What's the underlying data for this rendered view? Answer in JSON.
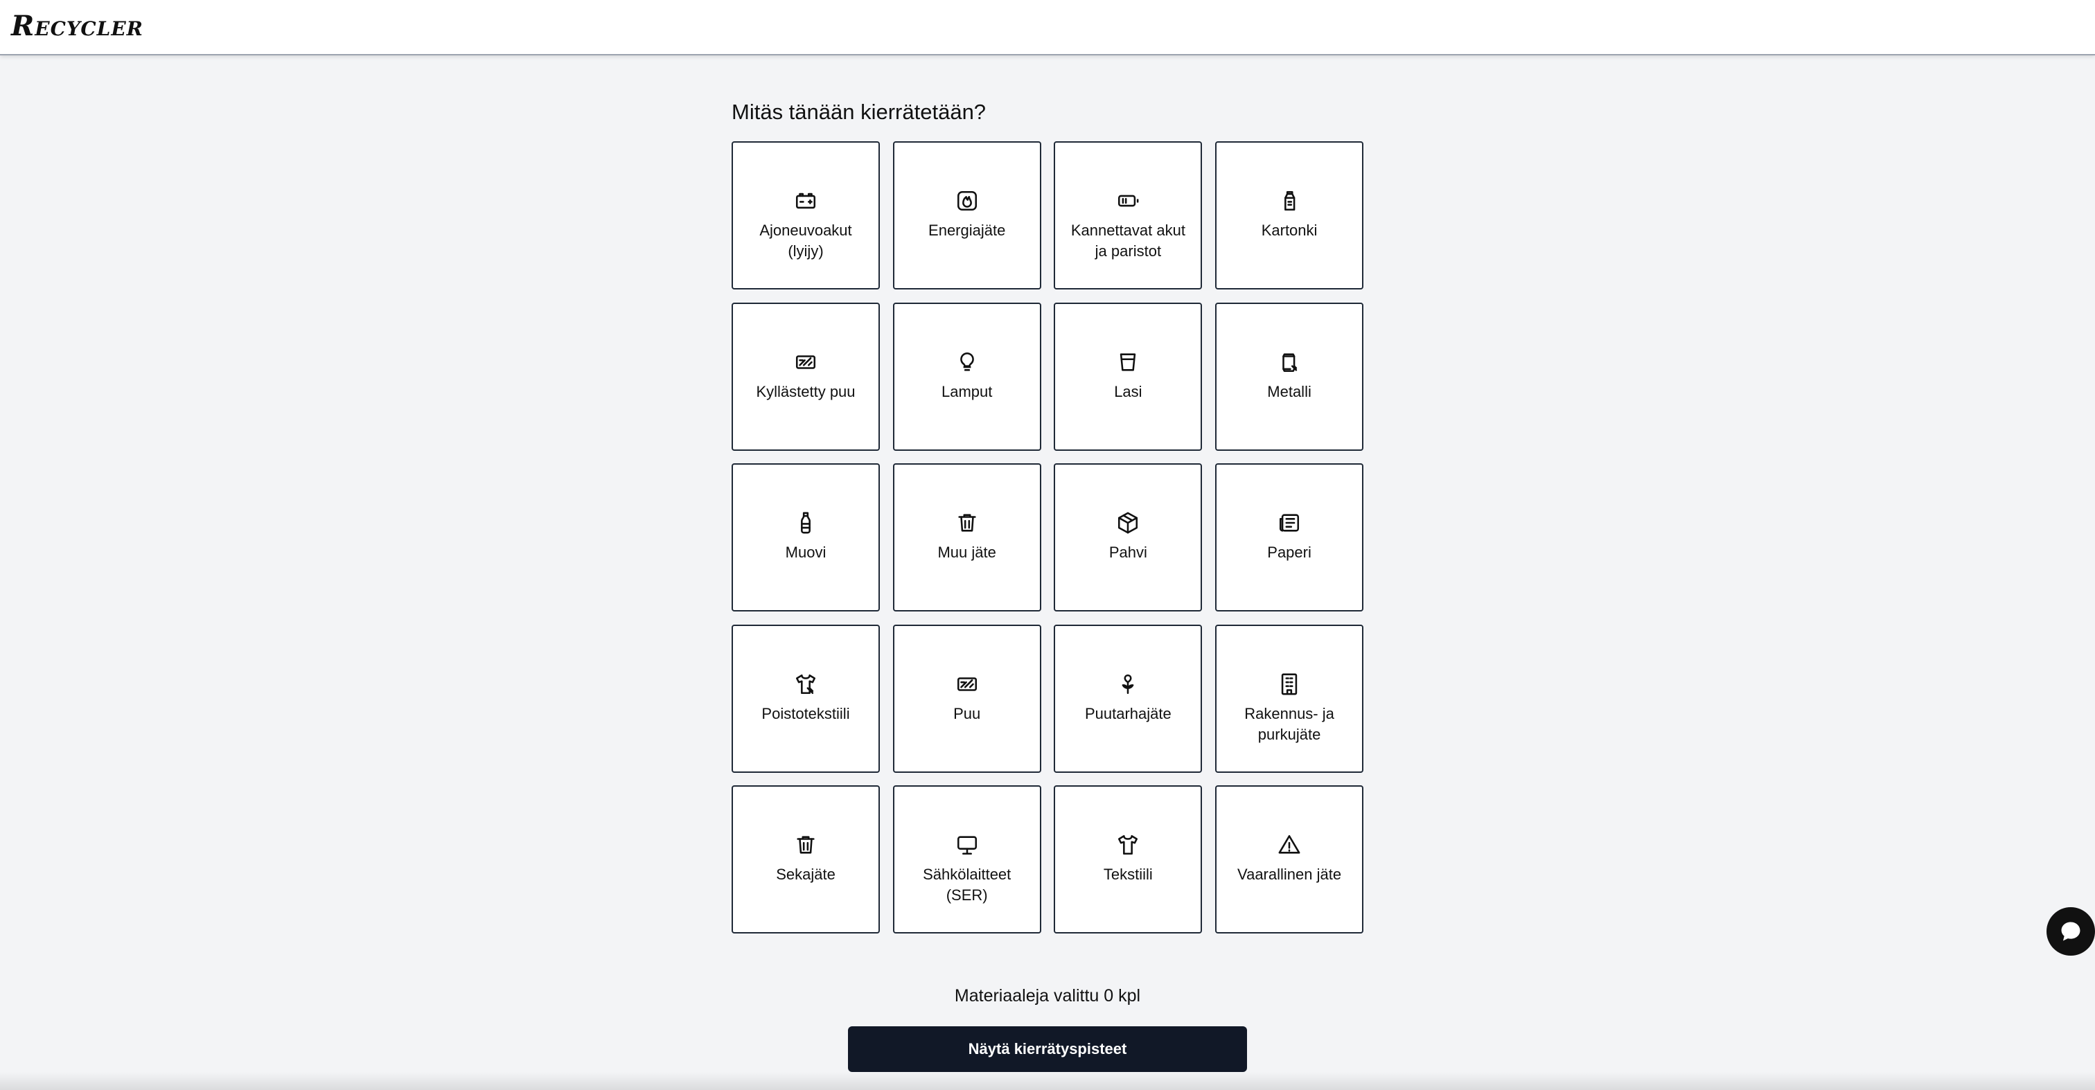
{
  "app": {
    "logo": "Recycler"
  },
  "main": {
    "heading": "Mitäs tänään kierrätetään?",
    "categories": [
      {
        "label": "Ajoneuvoakut (lyijy)",
        "icon": "car-battery-icon"
      },
      {
        "label": "Energiajäte",
        "icon": "flame-icon"
      },
      {
        "label": "Kannettavat akut ja paristot",
        "icon": "battery-icon"
      },
      {
        "label": "Kartonki",
        "icon": "milk-carton-icon"
      },
      {
        "label": "Kyllästetty puu",
        "icon": "treated-wood-icon"
      },
      {
        "label": "Lamput",
        "icon": "lightbulb-icon"
      },
      {
        "label": "Lasi",
        "icon": "glass-icon"
      },
      {
        "label": "Metalli",
        "icon": "can-icon"
      },
      {
        "label": "Muovi",
        "icon": "plastic-bottle-icon"
      },
      {
        "label": "Muu jäte",
        "icon": "trash-icon"
      },
      {
        "label": "Pahvi",
        "icon": "box-icon"
      },
      {
        "label": "Paperi",
        "icon": "newspaper-icon"
      },
      {
        "label": "Poistotekstiili",
        "icon": "shirt-slash-icon"
      },
      {
        "label": "Puu",
        "icon": "wood-icon"
      },
      {
        "label": "Puutarhajäte",
        "icon": "flower-icon"
      },
      {
        "label": "Rakennus- ja purkujäte",
        "icon": "building-icon"
      },
      {
        "label": "Sekajäte",
        "icon": "trash-icon"
      },
      {
        "label": "Sähkölaitteet (SER)",
        "icon": "monitor-icon"
      },
      {
        "label": "Tekstiili",
        "icon": "shirt-icon"
      },
      {
        "label": "Vaarallinen jäte",
        "icon": "warning-icon"
      }
    ],
    "selected_count_text": "Materiaaleja valittu 0 kpl",
    "show_button_label": "Näytä kierrätyspisteet"
  },
  "chat": {
    "icon": "chat-bubble-icon"
  },
  "colors": {
    "background": "#f3f4f6",
    "tile_border": "#1f2937",
    "button_bg": "#111827",
    "button_text": "#ffffff"
  }
}
